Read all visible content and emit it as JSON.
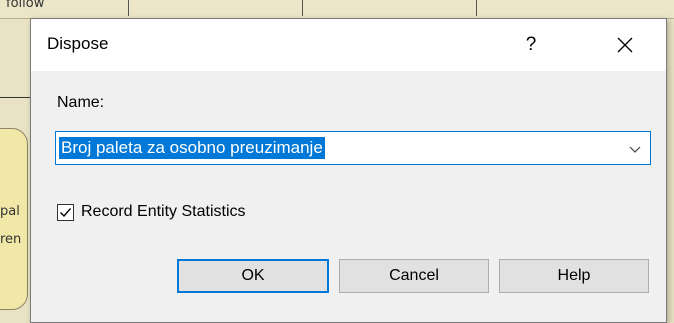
{
  "background": {
    "top_label": "follow",
    "left_text_1": "pal",
    "left_text_2": "ren"
  },
  "dialog": {
    "title": "Dispose",
    "help_glyph": "?",
    "close_icon": "close-icon",
    "name_label": "Name:",
    "name_value": "Broj paleta za osobno preuzimanje",
    "dropdown_icon": "chevron-down-icon",
    "record_stats_label": "Record Entity Statistics",
    "record_stats_checked": true,
    "ok_label": "OK",
    "cancel_label": "Cancel",
    "help_label": "Help"
  },
  "colors": {
    "accent": "#0078d7",
    "dialog_bg": "#f0f0f0",
    "titlebar_bg": "#ffffff",
    "button_bg": "#e1e1e1"
  }
}
